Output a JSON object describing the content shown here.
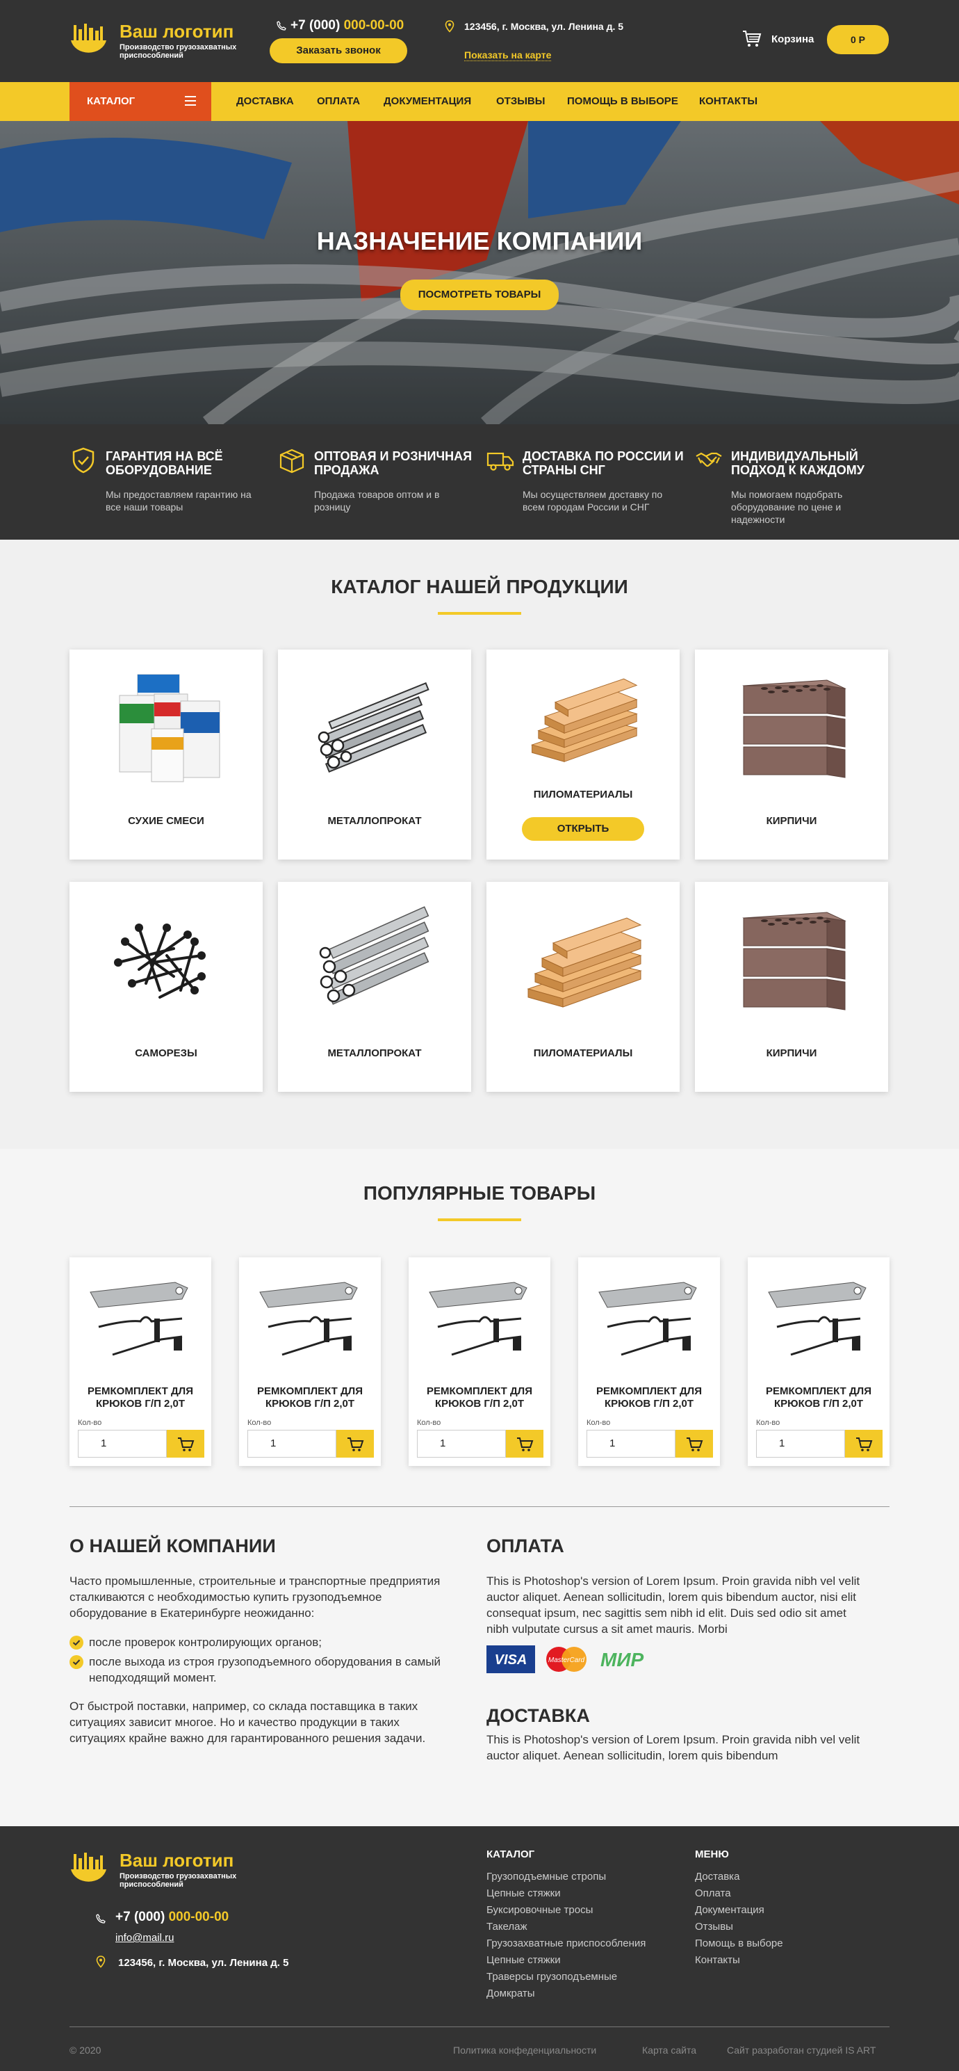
{
  "header": {
    "logo_title": "Ваш логотип",
    "logo_subtitle": "Производство грузозахватных приспособлений",
    "phone_prefix": "+7 (000) ",
    "phone_main": "000-00-00",
    "callback_label": "Заказать звонок",
    "address": "123456, г. Москва, ул. Ленина д. 5",
    "map_link": "Показать на карте",
    "cart_label": "Корзина",
    "cart_total": "0 Р"
  },
  "nav": {
    "catalog_label": "КАТАЛОГ",
    "items": [
      "ДОСТАВКА",
      "ОПЛАТА",
      "ДОКУМЕНТАЦИЯ",
      "ОТЗЫВЫ",
      "ПОМОЩЬ В ВЫБОРЕ",
      "КОНТАКТЫ"
    ]
  },
  "hero": {
    "title": "НАЗНАЧЕНИЕ КОМПАНИИ",
    "button": "ПОСМОТРЕТЬ ТОВАРЫ"
  },
  "features": [
    {
      "icon": "shield-check-icon",
      "title": "ГАРАНТИЯ НА ВСЁ ОБОРУДОВАНИЕ",
      "text": "Мы предоставляем гарантию на все наши товары"
    },
    {
      "icon": "box-icon",
      "title": "ОПТОВАЯ И РОЗНИЧНАЯ ПРОДАЖА",
      "text": "Продажа товаров оптом и в розницу"
    },
    {
      "icon": "truck-icon",
      "title": "ДОСТАВКА ПО РОССИИ И СТРАНЫ СНГ",
      "text": "Мы осуществляем доставку по всем городам России и СНГ"
    },
    {
      "icon": "handshake-icon",
      "title": "ИНДИВИДУАЛЬНЫЙ ПОДХОД К КАЖДОМУ",
      "text": "Мы помогаем подобрать оборудование по цене и надежности"
    }
  ],
  "catalog": {
    "title": "КАТАЛОГ НАШЕЙ ПРОДУКЦИИ",
    "open_label": "ОТКРЫТЬ",
    "items": [
      "СУХИЕ СМЕСИ",
      "МЕТАЛЛОПРОКАТ",
      "ПИЛОМАТЕРИАЛЫ",
      "КИРПИЧИ",
      "САМОРЕЗЫ",
      "МЕТАЛЛОПРОКАТ",
      "ПИЛОМАТЕРИАЛЫ",
      "КИРПИЧИ"
    ]
  },
  "popular": {
    "title": "ПОПУЛЯРНЫЕ ТОВАРЫ",
    "qty_label": "Кол-во",
    "products": [
      {
        "name": "РЕМКОМПЛЕКТ ДЛЯ КРЮКОВ Г/П 2,0Т",
        "qty": "1"
      },
      {
        "name": "РЕМКОМПЛЕКТ ДЛЯ КРЮКОВ Г/П 2,0Т",
        "qty": "1"
      },
      {
        "name": "РЕМКОМПЛЕКТ ДЛЯ КРЮКОВ Г/П 2,0Т",
        "qty": "1"
      },
      {
        "name": "РЕМКОМПЛЕКТ ДЛЯ КРЮКОВ Г/П 2,0Т",
        "qty": "1"
      },
      {
        "name": "РЕМКОМПЛЕКТ ДЛЯ КРЮКОВ Г/П 2,0Т",
        "qty": "1"
      }
    ]
  },
  "about": {
    "title": "О НАШЕЙ КОМПАНИИ",
    "intro": "Часто промышленные, строительные и транспортные предприятия сталкиваются с необходимостью купить грузоподъемное оборудование в Екатеринбурге неожиданно:",
    "bullets": [
      "после проверок контролирующих органов;",
      "после выхода из строя грузоподъемного оборудования в самый неподходящий момент."
    ],
    "outro": "От быстрой поставки, например, со склада поставщика в таких ситуациях зависит многое. Но и качество продукции в таких ситуациях крайне важно для гарантированного решения задачи."
  },
  "payment": {
    "title": "ОПЛАТА",
    "text": "This is Photoshop's version  of Lorem Ipsum. Proin gravida nibh vel velit auctor aliquet. Aenean sollicitudin, lorem quis bibendum auctor, nisi elit consequat ipsum, nec sagittis sem nibh id elit. Duis sed odio sit amet nibh vulputate cursus a sit amet mauris. Morbi",
    "logos": [
      "VISA",
      "MasterCard",
      "МИР"
    ]
  },
  "delivery": {
    "title": "ДОСТАВКА",
    "text": "This is Photoshop's version  of Lorem Ipsum. Proin gravida nibh vel velit auctor aliquet. Aenean sollicitudin, lorem quis bibendum"
  },
  "footer": {
    "logo_title": "Ваш логотип",
    "logo_subtitle": "Производство грузозахватных приспособлений",
    "phone_prefix": "+7 (000) ",
    "phone_main": "000-00-00",
    "email": "info@mail.ru",
    "address": "123456, г. Москва, ул. Ленина д. 5",
    "catalog_head": "КАТАЛОГ",
    "catalog_links": [
      "Грузоподъемные стропы",
      "Цепные стяжки",
      "Буксировочные тросы",
      "Такелаж",
      "Грузозахватные приспособления",
      "Цепные стяжки",
      "Траверсы грузоподъемные",
      "Домкраты"
    ],
    "menu_head": "МЕНЮ",
    "menu_links": [
      "Доставка",
      "Оплата",
      "Документация",
      "Отзывы",
      "Помощь в выборе",
      "Контакты"
    ],
    "copyright": "© 2020",
    "privacy": "Политика конфеденциальности",
    "sitemap": "Карта сайта",
    "studio": "Сайт разработан студией IS ART"
  },
  "colors": {
    "accent": "#f3c928",
    "dark": "#333333",
    "catalog_button": "#e04f1d"
  }
}
